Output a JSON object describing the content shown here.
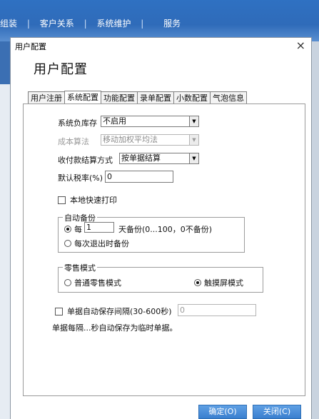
{
  "app_menu": [
    "组装",
    "客户关系",
    "系统维护",
    "服务"
  ],
  "app_menu_separator": "|",
  "dialog": {
    "title": "用户配置",
    "close_glyph": "×",
    "heading": "用户配置"
  },
  "tabs": [
    {
      "label": "用户注册",
      "active": false
    },
    {
      "label": "系统配置",
      "active": true
    },
    {
      "label": "功能配置",
      "active": false
    },
    {
      "label": "录单配置",
      "active": false
    },
    {
      "label": "小数配置",
      "active": false
    },
    {
      "label": "气泡信息",
      "active": false
    }
  ],
  "settings": {
    "negative_stock": {
      "label": "系统负库存",
      "value": "不启用"
    },
    "cost_method": {
      "label": "成本算法",
      "value": "移动加权平均法",
      "disabled": true
    },
    "payment_method": {
      "label": "收付款结算方式",
      "value": "按单据结算"
    },
    "default_tax": {
      "label": "默认税率(%)",
      "value": "0"
    },
    "quick_print": {
      "label": "本地快速打印",
      "checked": false
    }
  },
  "auto_backup": {
    "title": "自动备份",
    "every_prefix": "每",
    "days_value": "1",
    "days_suffix": "天备份(0...100，0不备份)",
    "on_exit_label": "每次退出时备份",
    "selected": "every_days"
  },
  "retail_mode": {
    "title": "零售模式",
    "normal_label": "普通零售模式",
    "touch_label": "触摸屏模式",
    "selected": "touch"
  },
  "auto_save": {
    "label": "单据自动保存间隔(30-600秒)",
    "checked": false,
    "value": "0",
    "note": "单据每隔...秒自动保存为临时单据。"
  },
  "buttons": {
    "ok": "确定(O)",
    "close": "关闭(C)"
  },
  "icons": {
    "dropdown": "▼"
  }
}
